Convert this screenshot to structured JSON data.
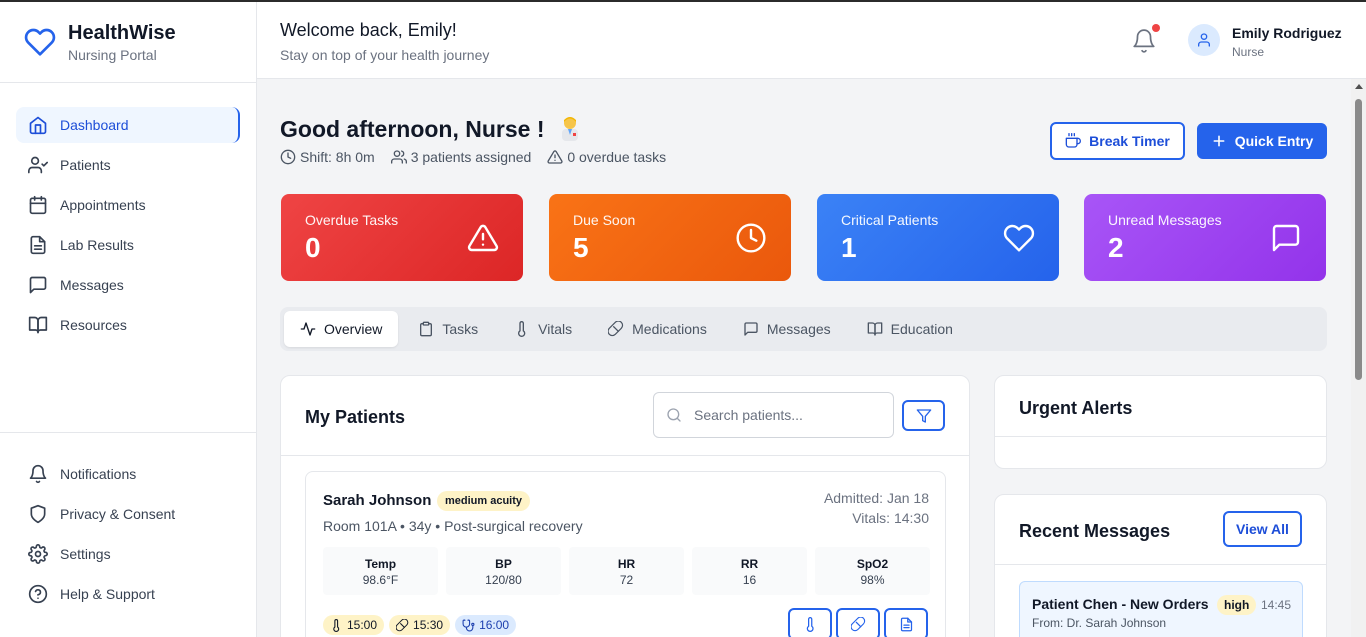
{
  "brand": {
    "title": "HealthWise",
    "subtitle": "Nursing Portal"
  },
  "sidebar": {
    "items": [
      {
        "label": "Dashboard",
        "icon": "home-icon",
        "active": true
      },
      {
        "label": "Patients",
        "icon": "user-check-icon"
      },
      {
        "label": "Appointments",
        "icon": "calendar-icon"
      },
      {
        "label": "Lab Results",
        "icon": "file-text-icon"
      },
      {
        "label": "Messages",
        "icon": "message-square-icon"
      },
      {
        "label": "Resources",
        "icon": "book-open-icon"
      }
    ],
    "bottom_items": [
      {
        "label": "Notifications",
        "icon": "bell-icon"
      },
      {
        "label": "Privacy & Consent",
        "icon": "shield-icon"
      },
      {
        "label": "Settings",
        "icon": "gear-icon"
      },
      {
        "label": "Help & Support",
        "icon": "help-circle-icon"
      }
    ]
  },
  "header": {
    "welcome": "Welcome back, Emily!",
    "subtitle": "Stay on top of your health journey",
    "user_name": "Emily Rodriguez",
    "user_role": "Nurse"
  },
  "main": {
    "greeting": "Good afternoon, Nurse !",
    "shift": "Shift: 8h 0m",
    "patients_assigned": "3 patients assigned",
    "overdue_tasks": "0 overdue tasks",
    "break_timer_label": "Break Timer",
    "quick_entry_label": "Quick Entry"
  },
  "stats": [
    {
      "label": "Overdue Tasks",
      "value": "0",
      "icon": "alert-triangle-icon",
      "color": "#dc2626"
    },
    {
      "label": "Due Soon",
      "value": "5",
      "icon": "clock-icon",
      "color": "#ea580c"
    },
    {
      "label": "Critical Patients",
      "value": "1",
      "icon": "heart-icon",
      "color": "#2563eb"
    },
    {
      "label": "Unread Messages",
      "value": "2",
      "icon": "message-square-icon",
      "color": "#9333ea"
    }
  ],
  "tabs": [
    {
      "label": "Overview",
      "icon": "activity-icon",
      "active": true
    },
    {
      "label": "Tasks",
      "icon": "clipboard-icon"
    },
    {
      "label": "Vitals",
      "icon": "thermometer-icon"
    },
    {
      "label": "Medications",
      "icon": "pill-icon"
    },
    {
      "label": "Messages",
      "icon": "message-square-icon"
    },
    {
      "label": "Education",
      "icon": "book-open-icon"
    }
  ],
  "patients_panel": {
    "title": "My Patients",
    "search_placeholder": "Search patients...",
    "patient": {
      "name": "Sarah Johnson",
      "acuity": "medium acuity",
      "details": "Room 101A • 34y • Post-surgical recovery",
      "admitted": "Admitted: Jan 18",
      "vitals_time": "Vitals: 14:30",
      "vitals": [
        {
          "label": "Temp",
          "value": "98.6°F"
        },
        {
          "label": "BP",
          "value": "120/80"
        },
        {
          "label": "HR",
          "value": "72"
        },
        {
          "label": "RR",
          "value": "16"
        },
        {
          "label": "SpO2",
          "value": "98%"
        }
      ],
      "schedule": [
        {
          "time": "15:00",
          "icon": "thermometer-icon"
        },
        {
          "time": "15:30",
          "icon": "pill-icon"
        },
        {
          "time": "16:00",
          "icon": "stethoscope-icon"
        }
      ]
    }
  },
  "alerts_panel": {
    "title": "Urgent Alerts"
  },
  "messages_panel": {
    "title": "Recent Messages",
    "view_all_label": "View All",
    "messages": [
      {
        "title": "Patient Chen - New Orders",
        "priority": "high",
        "time": "14:45",
        "from": "From: Dr. Sarah Johnson"
      }
    ]
  }
}
